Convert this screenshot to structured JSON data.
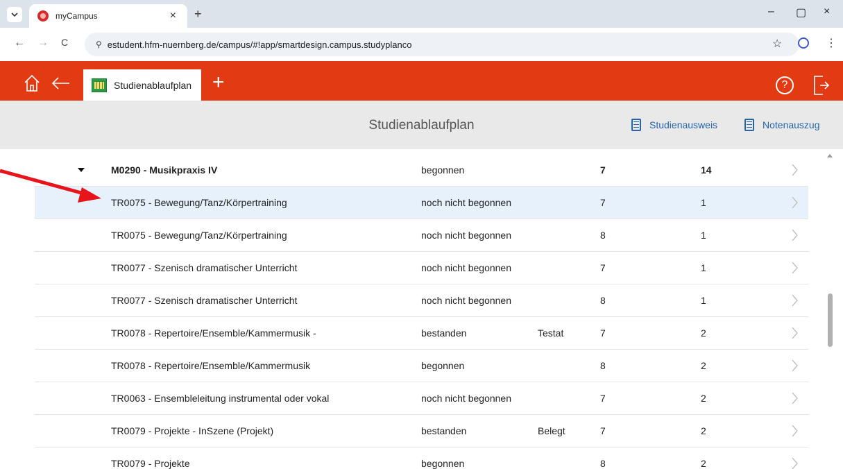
{
  "browser": {
    "tab_title": "myCampus",
    "tab_close": "×",
    "new_tab": "+",
    "url": "estudent.hfm-nuernberg.de/campus/#!app/smartdesign.campus.studyplanco",
    "minimize": "–",
    "restore": "▢",
    "close": "×",
    "back": "←",
    "forward": "→",
    "reload": "C",
    "star": "☆",
    "menu": "⋮",
    "site_info": "⚲"
  },
  "app": {
    "tab_label": "Studienablaufplan",
    "plus": "+",
    "help": "?",
    "page_title": "Studienablaufplan",
    "btn_studienausweis": "Studienausweis",
    "btn_notenauszug": "Notenauszug",
    "accent_color": "#e23a13",
    "link_color": "#2565a8"
  },
  "table": {
    "group": {
      "name": "M0290 - Musikpraxis IV",
      "status": "begonnen",
      "grade": "",
      "semester": "7",
      "cp": "14"
    },
    "rows": [
      {
        "name": "TR0075 - Bewegung/Tanz/Körpertraining",
        "status": "noch nicht begonnen",
        "grade": "",
        "semester": "7",
        "cp": "1"
      },
      {
        "name": "TR0075 - Bewegung/Tanz/Körpertraining",
        "status": "noch nicht begonnen",
        "grade": "",
        "semester": "8",
        "cp": "1"
      },
      {
        "name": "TR0077 - Szenisch dramatischer Unterricht",
        "status": "noch nicht begonnen",
        "grade": "",
        "semester": "7",
        "cp": "1"
      },
      {
        "name": "TR0077 - Szenisch dramatischer Unterricht",
        "status": "noch nicht begonnen",
        "grade": "",
        "semester": "8",
        "cp": "1"
      },
      {
        "name": "TR0078 - Repertoire/Ensemble/Kammermusik -",
        "status": "bestanden",
        "grade": "Testat",
        "semester": "7",
        "cp": "2"
      },
      {
        "name": "TR0078 - Repertoire/Ensemble/Kammermusik",
        "status": "begonnen",
        "grade": "",
        "semester": "8",
        "cp": "2"
      },
      {
        "name": "TR0063 - Ensembleleitung instrumental oder vokal",
        "status": "noch nicht begonnen",
        "grade": "",
        "semester": "7",
        "cp": "2"
      },
      {
        "name": "TR0079 - Projekte - InSzene (Projekt)",
        "status": "bestanden",
        "grade": "Belegt",
        "semester": "7",
        "cp": "2"
      },
      {
        "name": "TR0079 - Projekte",
        "status": "begonnen",
        "grade": "",
        "semester": "8",
        "cp": "2"
      }
    ]
  }
}
